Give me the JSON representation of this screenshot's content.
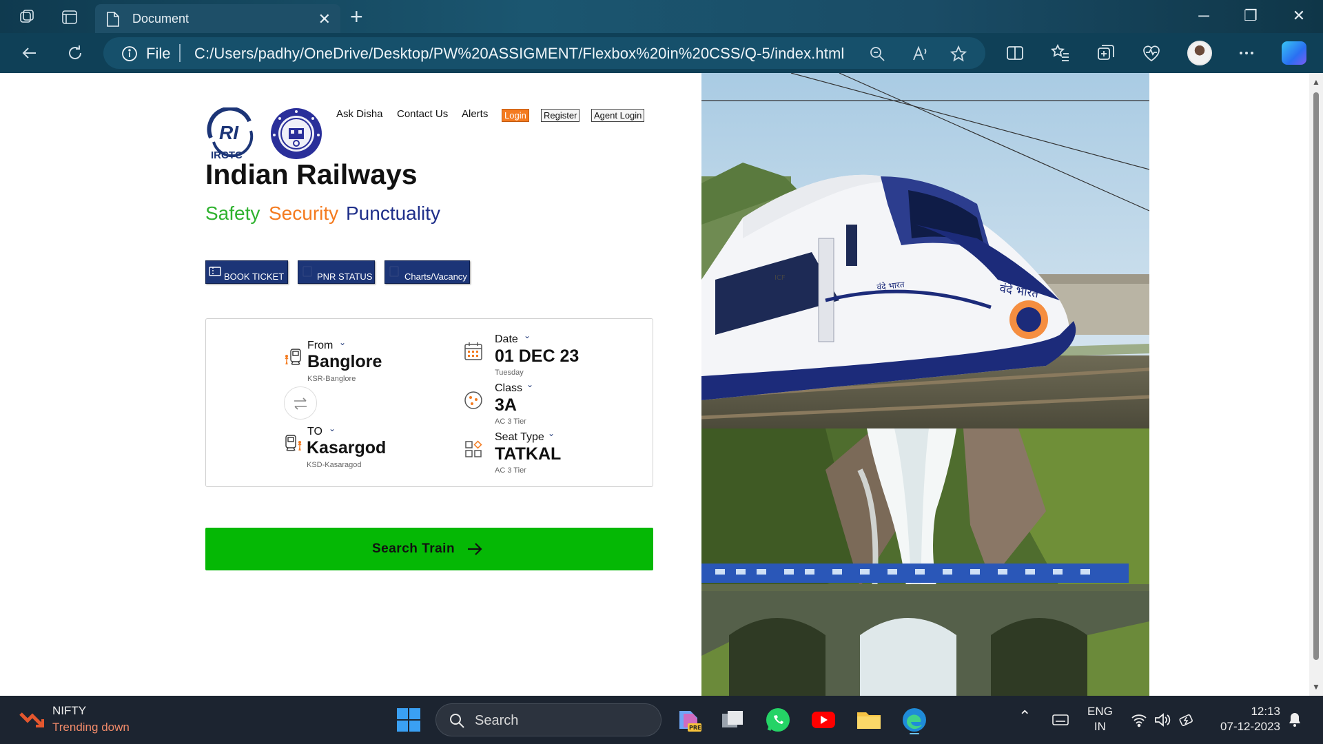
{
  "browser": {
    "tab_title": "Document",
    "address_scheme": "File",
    "url": "C:/Users/padhy/OneDrive/Desktop/PW%20ASSIGMENT/Flexbox%20in%20CSS/Q-5/index.html"
  },
  "site": {
    "nav": {
      "ask_disha": "Ask Disha",
      "contact_us": "Contact Us",
      "alerts": "Alerts",
      "login": "Login",
      "register": "Register",
      "agent_login": "Agent Login"
    },
    "logo_text": "IRCTC",
    "title": "Indian Railways",
    "tagline": {
      "safety": "Safety",
      "security": "Security",
      "punctuality": "Punctuality",
      "colors": {
        "safety": "#2fb22f",
        "security": "#f47b20",
        "punctuality": "#1f2f8a"
      }
    },
    "quick_buttons": {
      "book_ticket": "BOOK TICKET",
      "pnr_status": "PNR STATUS",
      "charts_vacancy": "Charts/Vacancy"
    },
    "booking": {
      "from": {
        "label": "From",
        "value": "Banglore",
        "sub": "KSR-Banglore"
      },
      "to": {
        "label": "TO",
        "value": "Kasargod",
        "sub": "KSD-Kasaragod"
      },
      "date": {
        "label": "Date",
        "value": "01 DEC 23",
        "sub": "Tuesday"
      },
      "class": {
        "label": "Class",
        "value": "3A",
        "sub": "AC 3 Tier"
      },
      "seat_type": {
        "label": "Seat Type",
        "value": "TATKAL",
        "sub": "AC 3 Tier"
      }
    },
    "search_button": "Search Train",
    "accent_color": "#05b805",
    "primary_color": "#1c3577"
  },
  "train_livery_text": {
    "hindi_name": "वंदे भारत",
    "icf": "ICF"
  },
  "taskbar": {
    "widget_title": "NIFTY",
    "widget_status": "Trending down",
    "search_placeholder": "Search",
    "language": "ENG",
    "region": "IN",
    "time": "12:13",
    "date": "07-12-2023"
  }
}
